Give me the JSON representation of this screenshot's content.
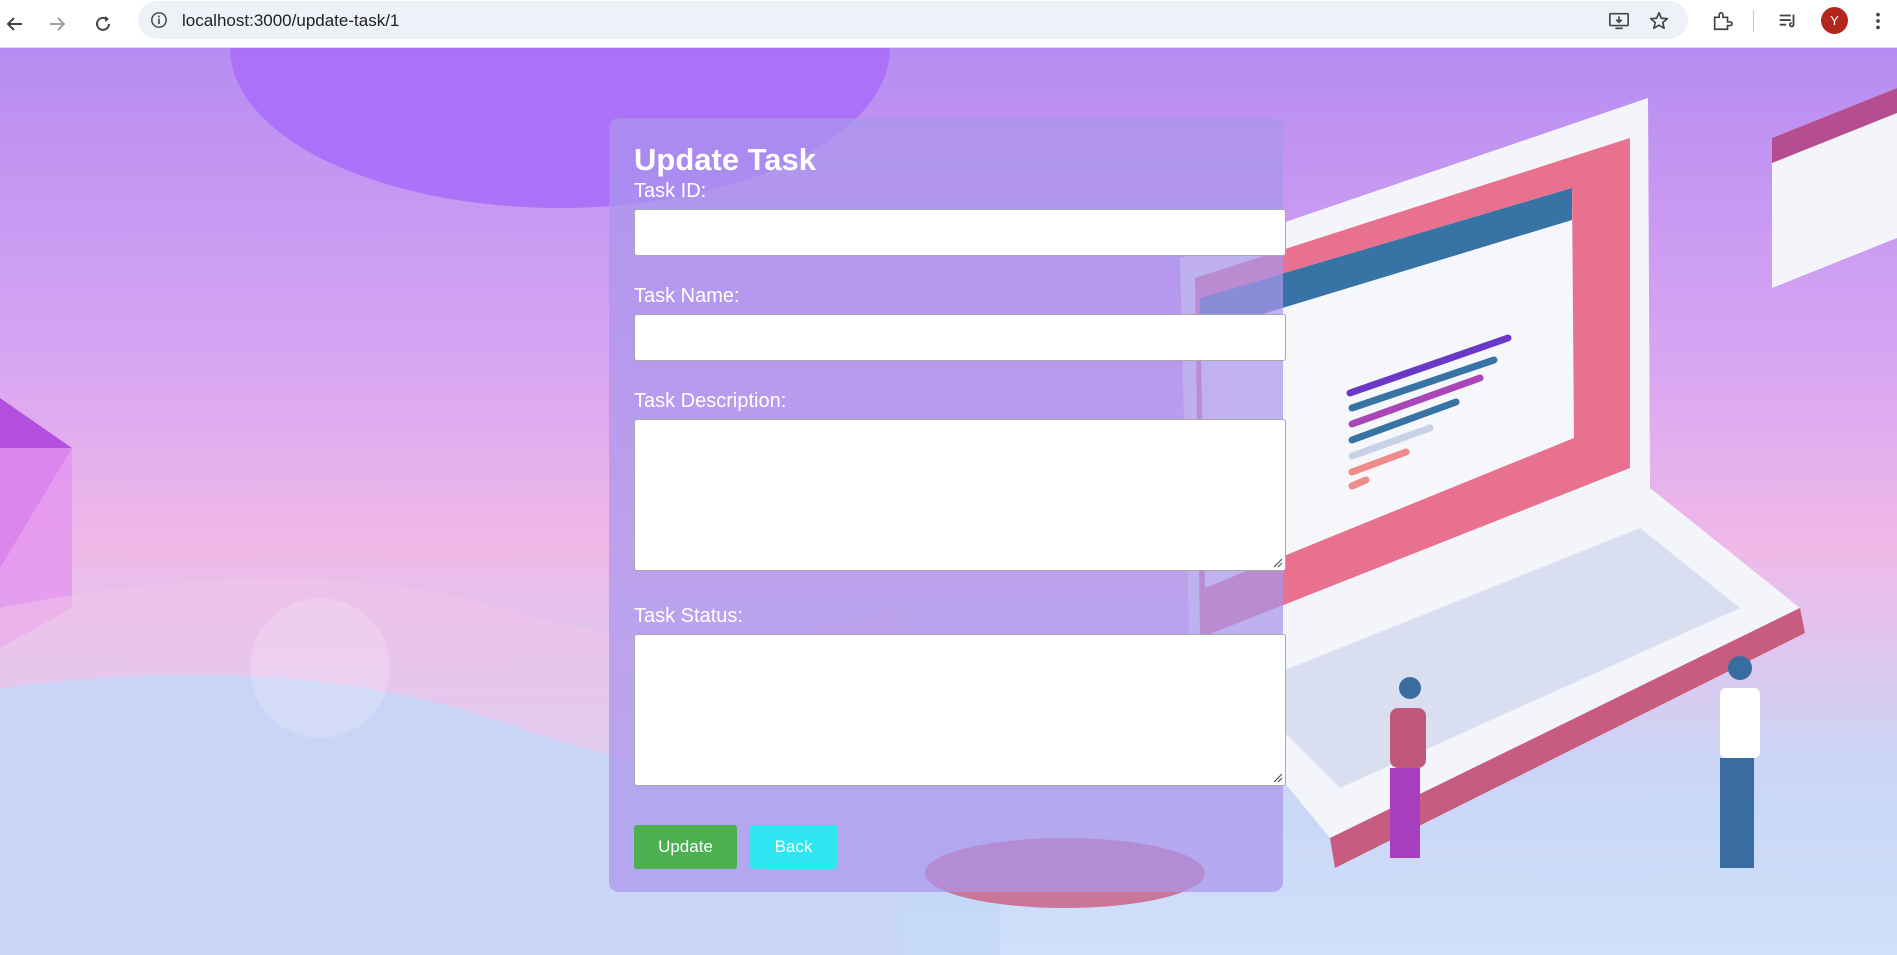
{
  "browser": {
    "url": "localhost:3000/update-task/1",
    "profile_initial": "Y",
    "icons": [
      "back-arrow-icon",
      "forward-arrow-icon",
      "reload-icon",
      "site-info-icon",
      "install-app-icon",
      "bookmark-star-icon",
      "extensions-icon",
      "reading-list-icon",
      "more-menu-icon"
    ]
  },
  "form": {
    "title": "Update Task",
    "fields": {
      "task_id": {
        "label": "Task ID:",
        "value": ""
      },
      "task_name": {
        "label": "Task Name:",
        "value": ""
      },
      "task_description": {
        "label": "Task Description:",
        "value": ""
      },
      "task_status": {
        "label": "Task Status:",
        "value": ""
      }
    },
    "buttons": {
      "update": "Update",
      "back": "Back"
    }
  },
  "colors": {
    "update_button": "#4caf50",
    "back_button": "#2de6f0",
    "card": "#aa96eb",
    "avatar": "#b3261e"
  }
}
